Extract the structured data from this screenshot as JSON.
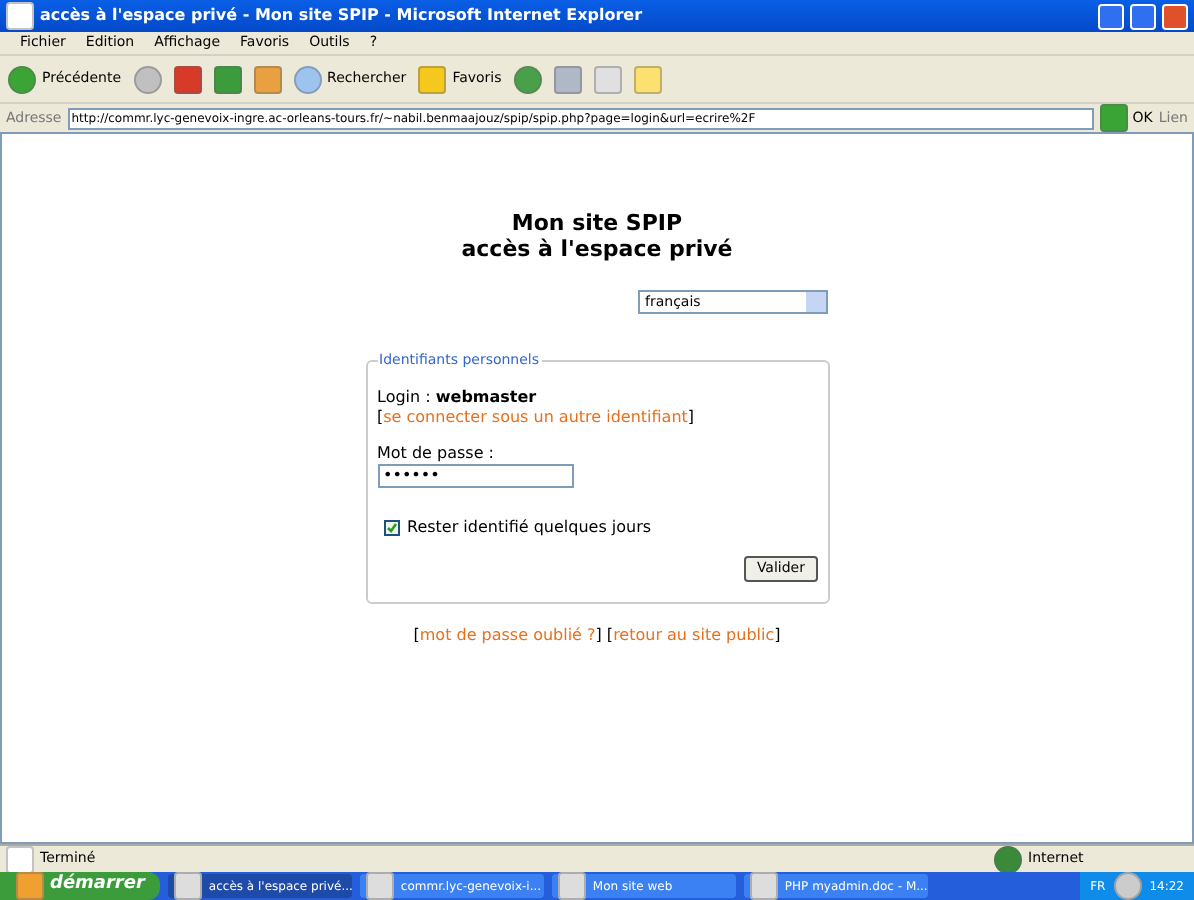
{
  "window": {
    "title": "accès à l'espace privé - Mon site SPIP - Microsoft Internet Explorer"
  },
  "menu": [
    "Fichier",
    "Edition",
    "Affichage",
    "Favoris",
    "Outils",
    "?"
  ],
  "toolbar": {
    "back": "Précédente",
    "search": "Rechercher",
    "favorites": "Favoris"
  },
  "address_bar": {
    "label": "Adresse",
    "url": "http://commr.lyc-genevoix-ingre.ac-orleans-tours.fr/~nabil.benmaajouz/spip/spip.php?page=login&url=ecrire%2F",
    "go": "OK",
    "links": "Lien"
  },
  "page": {
    "site_title": "Mon site SPIP",
    "subtitle": "accès à l'espace privé",
    "language": "français",
    "fieldset": {
      "legend": "Identifiants personnels",
      "login_label": "Login : ",
      "login_value": "webmaster",
      "alt_login": [
        {
          "kind": "text",
          "text": "["
        },
        {
          "kind": "link",
          "text": "se connecter sous un autre identifiant"
        },
        {
          "kind": "text",
          "text": "]"
        }
      ],
      "password_label": "Mot de passe :",
      "password_value": "••••••",
      "remember": {
        "label": "Rester identifié quelques jours",
        "checked": true
      },
      "submit": "Valider"
    },
    "footer": [
      {
        "kind": "text",
        "text": "["
      },
      {
        "kind": "link",
        "text": "mot de passe oublié ?"
      },
      {
        "kind": "text",
        "text": "] ["
      },
      {
        "kind": "link",
        "text": "retour au site public"
      },
      {
        "kind": "text",
        "text": "]"
      }
    ]
  },
  "status_bar": {
    "text": "Terminé",
    "zone": "Internet"
  },
  "taskbar": {
    "start": "démarrer",
    "tasks": [
      {
        "label": "accès à l'espace privé...",
        "selected": true
      },
      {
        "label": "commr.lyc-genevoix-i...",
        "selected": false
      },
      {
        "label": "Mon site web",
        "selected": false
      },
      {
        "label": "PHP myadmin.doc - M...",
        "selected": false
      }
    ],
    "language": "FR",
    "clock": "14:22"
  }
}
